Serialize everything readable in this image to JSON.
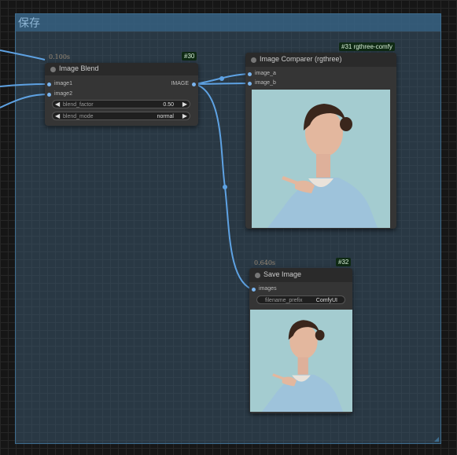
{
  "group": {
    "title": "保存"
  },
  "nodes": {
    "blend": {
      "badge": "#30",
      "time": "0.100s",
      "title": "Image Blend",
      "inputs": [
        "image1",
        "image2"
      ],
      "output": "IMAGE",
      "widgets": [
        {
          "label": "blend_factor",
          "value": "0.50"
        },
        {
          "label": "blend_mode",
          "value": "normal"
        }
      ]
    },
    "comparer": {
      "badge": "#31 rgthree-comfy",
      "title": "Image Comparer (rgthree)",
      "inputs": [
        "image_a",
        "image_b"
      ]
    },
    "save": {
      "badge": "#32",
      "time": "0.640s",
      "title": "Save Image",
      "inputs": [
        "images"
      ],
      "widgets": [
        {
          "label": "filename_prefix",
          "value": "ComfyUI"
        }
      ]
    }
  },
  "colors": {
    "link": "#5ea2e3",
    "group": "#3d6c8e",
    "badge_bg": "#0f2a14"
  },
  "icons": [
    "arrow-left-icon",
    "arrow-right-icon",
    "node-status-dot-icon"
  ]
}
